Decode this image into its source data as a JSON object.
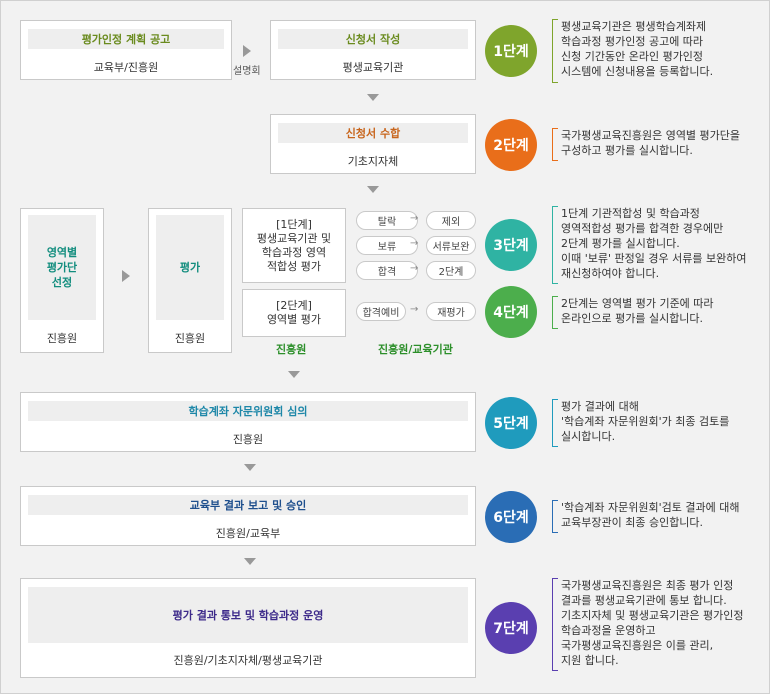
{
  "steps": {
    "s1": {
      "left_title": "평가인정 계획 공고",
      "left_sub": "교육부/진흥원",
      "between": "설명회",
      "right_title": "신청서 작성",
      "right_sub": "평생교육기관",
      "label": "1단계",
      "desc": [
        "평생교육기관은 평생학습계좌제",
        "학습과정 평가인정 공고에 따라",
        "신청 기간동안 온라인 평가인정",
        "시스템에 신청내용을 등록합니다."
      ]
    },
    "s2": {
      "title": "신청서 수합",
      "sub": "기초지자체",
      "label": "2단계",
      "desc": [
        "국가평생교육진흥원은 영역별 평가단을",
        "구성하고 평가를 실시합니다."
      ]
    },
    "s34": {
      "area_title": [
        "영역별",
        "평가단",
        "선정"
      ],
      "area_sub": "진흥원",
      "eval_title": "평가",
      "eval_sub": "진흥원",
      "stage1": [
        "[1단계]",
        "평생교육기관 및",
        "학습과정 영역",
        "적합성 평가"
      ],
      "stage2": [
        "[2단계]",
        "영역별 평가"
      ],
      "col_left_label": "진흥원",
      "col_right_label": "진흥원/교육기관",
      "pairs1": [
        [
          "탈락",
          "제외"
        ],
        [
          "보류",
          "서류보완"
        ],
        [
          "합격",
          "2단계"
        ]
      ],
      "pairs2": [
        [
          "합격예비",
          "재평가"
        ]
      ],
      "label3": "3단계",
      "desc3": [
        "1단계 기관적합성 및 학습과정",
        "영역적합성 평가를 합격한 경우에만",
        "2단계 평가를 실시합니다.",
        "이때 '보류' 판정일 경우 서류를 보완하여",
        "재신청하여야 합니다."
      ],
      "label4": "4단계",
      "desc4": [
        "2단계는 영역별 평가 기준에 따라",
        "온라인으로 평가를 실시합니다."
      ]
    },
    "s5": {
      "title": "학습계좌 자문위원회 심의",
      "sub": "진흥원",
      "label": "5단계",
      "desc": [
        "평가 결과에 대해",
        "'학습계좌 자문위원회'가 최종 검토를",
        "실시합니다."
      ]
    },
    "s6": {
      "title": "교육부 결과 보고 및 승인",
      "sub": "진흥원/교육부",
      "label": "6단계",
      "desc": [
        "'학습계좌 자문위원회'검토 결과에 대해",
        "교육부장관이 최종 승인합니다."
      ]
    },
    "s7": {
      "title": "평가 결과 통보 및 학습과정 운영",
      "sub": "진흥원/기초지자체/평생교육기관",
      "label": "7단계",
      "desc": [
        "국가평생교육진흥원은 최종 평가 인정",
        "결과를 평생교육기관에 통보 합니다.",
        "기초지자체 및 평생교육기관은 평가인정",
        "학습과정을 운영하고",
        "국가평생교육진흥원은 이를 관리,",
        "지원 합니다."
      ]
    }
  },
  "arrow_glyph": "→",
  "colors": {
    "s1": "#7fa52c",
    "s2": "#e96e1a",
    "s3": "#2fb3a3",
    "s4": "#4cae4c",
    "s5": "#1f9bbd",
    "s6": "#2a6db5",
    "s7": "#5a3fb0",
    "s1_title": "#6a8b1e",
    "s2_title": "#c8651c",
    "s3_title": "#128d7e",
    "s5_title": "#1d87a8",
    "s6_title": "#1e4f8d",
    "s7_title": "#3d2a8a",
    "green_label": "#2c8f2a"
  }
}
